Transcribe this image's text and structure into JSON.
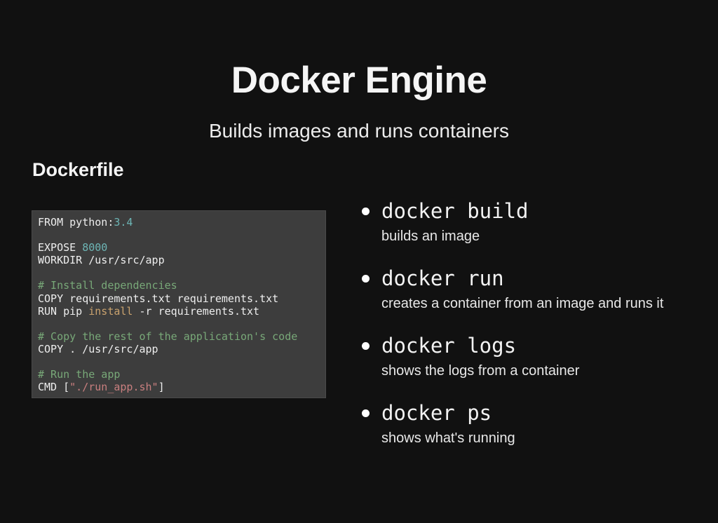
{
  "slide": {
    "title": "Docker Engine",
    "subtitle": "Builds images and runs containers",
    "section_heading": "Dockerfile"
  },
  "colors": {
    "background": "#111111",
    "text": "#f1f1f1",
    "code_background": "#3d3d3d",
    "code_text": "#eeeeee",
    "token_number": "#6db5b5",
    "token_comment": "#78a878",
    "token_builtin": "#c9a26e",
    "token_string": "#c97f7f",
    "bullet": "#ffffff"
  },
  "dockerfile": {
    "lines": [
      [
        {
          "text": "FROM python:",
          "type": "plain"
        },
        {
          "text": "3.4",
          "type": "number"
        }
      ],
      [],
      [
        {
          "text": "EXPOSE ",
          "type": "plain"
        },
        {
          "text": "8000",
          "type": "number"
        }
      ],
      [
        {
          "text": "WORKDIR /usr/src/app",
          "type": "plain"
        }
      ],
      [],
      [
        {
          "text": "# Install dependencies",
          "type": "comment"
        }
      ],
      [
        {
          "text": "COPY requirements.txt requirements.txt",
          "type": "plain"
        }
      ],
      [
        {
          "text": "RUN pip ",
          "type": "plain"
        },
        {
          "text": "install",
          "type": "builtin"
        },
        {
          "text": " -r requirements.txt",
          "type": "plain"
        }
      ],
      [],
      [
        {
          "text": "# Copy the rest of the application's code",
          "type": "comment"
        }
      ],
      [
        {
          "text": "COPY . /usr/src/app",
          "type": "plain"
        }
      ],
      [],
      [
        {
          "text": "# Run the app",
          "type": "comment"
        }
      ],
      [
        {
          "text": "CMD [",
          "type": "plain"
        },
        {
          "text": "\"./run_app.sh\"",
          "type": "string"
        },
        {
          "text": "]",
          "type": "plain"
        }
      ]
    ]
  },
  "commands": {
    "items": [
      {
        "command": "docker build",
        "description": "builds an image"
      },
      {
        "command": "docker run",
        "description": "creates a container from an image and runs it"
      },
      {
        "command": "docker logs",
        "description": "shows the logs from a container"
      },
      {
        "command": "docker ps",
        "description": "shows what's running"
      }
    ]
  }
}
